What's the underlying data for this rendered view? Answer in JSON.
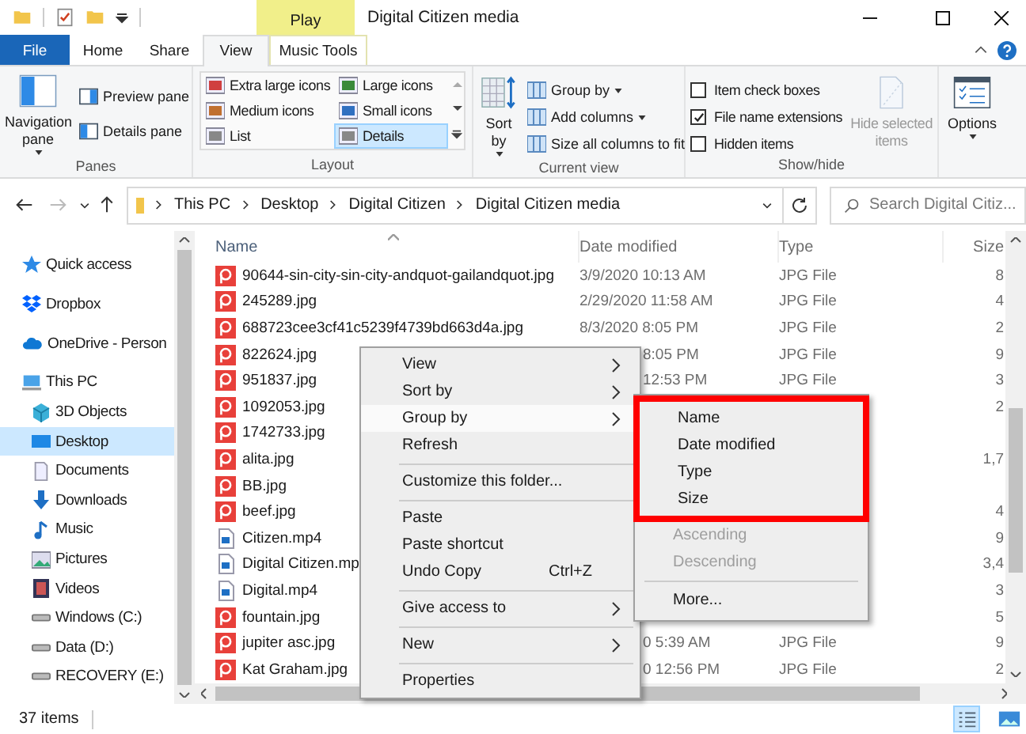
{
  "window": {
    "title": "Digital Citizen media",
    "context_tab": "Play"
  },
  "ribbon_tabs": [
    {
      "label": "File",
      "kind": "file",
      "selected": false
    },
    {
      "label": "Home",
      "kind": "tab",
      "selected": false
    },
    {
      "label": "Share",
      "kind": "tab",
      "selected": false
    },
    {
      "label": "View",
      "kind": "tab",
      "selected": true
    },
    {
      "label": "Music Tools",
      "kind": "context",
      "selected": false
    }
  ],
  "ribbon": {
    "panes": {
      "label": "Panes",
      "navigation": "Navigation pane",
      "items": [
        "Preview pane",
        "Details pane"
      ]
    },
    "layout": {
      "label": "Layout",
      "items": [
        {
          "label": "Extra large icons",
          "selected": false
        },
        {
          "label": "Large icons",
          "selected": false
        },
        {
          "label": "Medium icons",
          "selected": false
        },
        {
          "label": "Small icons",
          "selected": false
        },
        {
          "label": "List",
          "selected": false
        },
        {
          "label": "Details",
          "selected": true
        }
      ]
    },
    "current_view": {
      "label": "Current view",
      "sort": "Sort by",
      "items": [
        {
          "label": "Group by",
          "dropdown": true
        },
        {
          "label": "Add columns",
          "dropdown": true
        },
        {
          "label": "Size all columns to fit",
          "dropdown": false
        }
      ]
    },
    "show_hide": {
      "label": "Show/hide",
      "checks": [
        {
          "label": "Item check boxes",
          "checked": false
        },
        {
          "label": "File name extensions",
          "checked": true
        },
        {
          "label": "Hidden items",
          "checked": false
        }
      ],
      "hide_selected": {
        "label": "Hide selected items",
        "disabled": true
      }
    },
    "options": {
      "label": "Options"
    }
  },
  "address": {
    "path": [
      "This PC",
      "Desktop",
      "Digital Citizen",
      "Digital Citizen media"
    ]
  },
  "search": {
    "placeholder": "Search Digital Citiz..."
  },
  "navigation": [
    {
      "label": "Quick access",
      "selected": false
    },
    {
      "label": "Dropbox",
      "selected": false
    },
    {
      "label": "OneDrive - Person",
      "selected": false
    },
    {
      "label": "This PC",
      "selected": false,
      "children": [
        {
          "label": "3D Objects",
          "selected": false
        },
        {
          "label": "Desktop",
          "selected": true
        },
        {
          "label": "Documents",
          "selected": false
        },
        {
          "label": "Downloads",
          "selected": false
        },
        {
          "label": "Music",
          "selected": false
        },
        {
          "label": "Pictures",
          "selected": false
        },
        {
          "label": "Videos",
          "selected": false
        },
        {
          "label": "Windows (C:)",
          "selected": false
        },
        {
          "label": "Data (D:)",
          "selected": false
        },
        {
          "label": "RECOVERY (E:)",
          "selected": false
        }
      ]
    }
  ],
  "table": {
    "columns": [
      "Name",
      "Date modified",
      "Type",
      "Size"
    ],
    "rows": [
      {
        "kind": "image",
        "name": "90644-sin-city-sin-city-andquot-gailandquot.jpg",
        "date": "3/9/2020 10:13 AM",
        "type": "JPG File",
        "size": "8"
      },
      {
        "kind": "image",
        "name": "245289.jpg",
        "date": "2/29/2020 11:58 AM",
        "type": "JPG File",
        "size": "4"
      },
      {
        "kind": "image",
        "name": "688723cee3cf41c5239f4739bd663d4a.jpg",
        "date": "8/3/2020 8:05 PM",
        "type": "JPG File",
        "size": "2"
      },
      {
        "kind": "image",
        "name": "822624.jpg",
        "date_tail": "8:05 PM",
        "type": "JPG File",
        "size": "9"
      },
      {
        "kind": "image",
        "name": "951837.jpg",
        "date_tail": "12:53 PM",
        "type": "JPG File",
        "size": "3"
      },
      {
        "kind": "image",
        "name": "1092053.jpg",
        "size": "2"
      },
      {
        "kind": "image",
        "name": "1742733.jpg"
      },
      {
        "kind": "image",
        "name": "alita.jpg",
        "size": "1,7"
      },
      {
        "kind": "image",
        "name": "BB.jpg"
      },
      {
        "kind": "image",
        "name": "beef.jpg",
        "size": "4"
      },
      {
        "kind": "video",
        "name": "Citizen.mp4",
        "size": "9"
      },
      {
        "kind": "video",
        "name": "Digital Citizen.mp",
        "size": "3,4"
      },
      {
        "kind": "video",
        "name": "Digital.mp4",
        "size": "3"
      },
      {
        "kind": "image",
        "name": "fountain.jpg",
        "size": "5"
      },
      {
        "kind": "image",
        "name": "jupiter asc.jpg",
        "date_tail": "0 5:39 AM",
        "type": "JPG File",
        "size": "9"
      },
      {
        "kind": "image",
        "name": "Kat Graham.jpg",
        "date_tail": "0 12:56 PM",
        "type": "JPG File",
        "size": "2"
      }
    ]
  },
  "context_menu": {
    "items": [
      {
        "kind": "submenu",
        "label": "View",
        "selected": false
      },
      {
        "kind": "submenu",
        "label": "Sort by",
        "selected": false
      },
      {
        "kind": "submenu",
        "label": "Group by",
        "selected": true
      },
      {
        "kind": "item",
        "label": "Refresh",
        "selected": false
      },
      {
        "kind": "separator"
      },
      {
        "kind": "item",
        "label": "Customize this folder...",
        "selected": false
      },
      {
        "kind": "separator"
      },
      {
        "kind": "item",
        "label": "Paste",
        "selected": false
      },
      {
        "kind": "item",
        "label": "Paste shortcut",
        "selected": false
      },
      {
        "kind": "item",
        "label": "Undo Copy",
        "shortcut": "Ctrl+Z",
        "selected": false
      },
      {
        "kind": "separator"
      },
      {
        "kind": "submenu",
        "label": "Give access to",
        "selected": false
      },
      {
        "kind": "separator"
      },
      {
        "kind": "submenu",
        "label": "New",
        "selected": false
      },
      {
        "kind": "separator"
      },
      {
        "kind": "item",
        "label": "Properties",
        "selected": false
      }
    ]
  },
  "submenu": {
    "framed": [
      "Name",
      "Date modified",
      "Type",
      "Size"
    ],
    "items": [
      {
        "kind": "item",
        "label": "Ascending",
        "disabled": true
      },
      {
        "kind": "item",
        "label": "Descending",
        "disabled": true
      },
      {
        "kind": "separator"
      },
      {
        "kind": "item",
        "label": "More...",
        "disabled": false
      }
    ]
  },
  "status_bar": {
    "count": "37 items"
  }
}
